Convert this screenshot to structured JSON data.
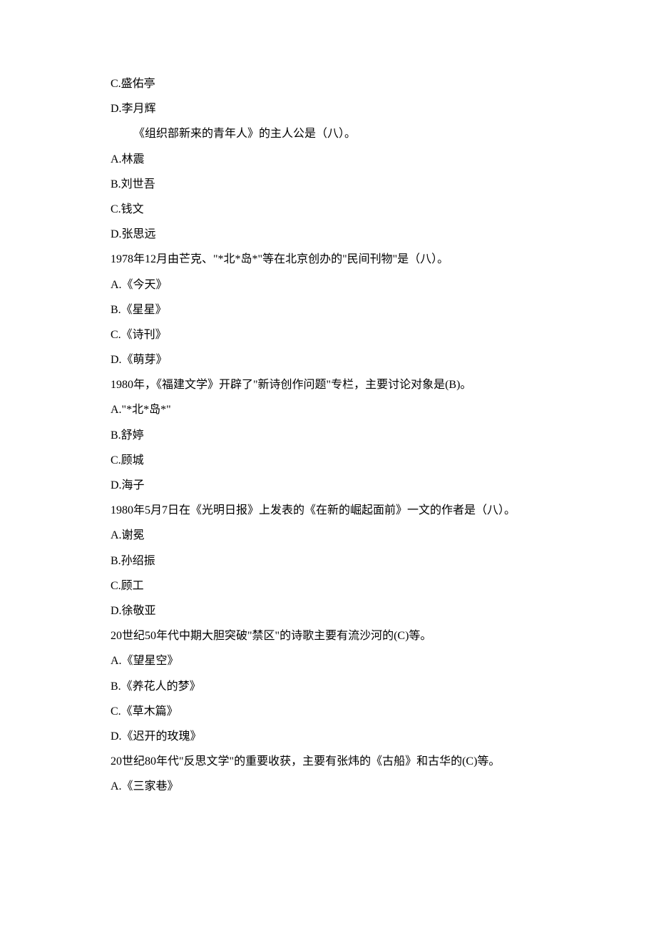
{
  "lines": [
    {
      "text": "C.盛佑亭",
      "indent": false
    },
    {
      "text": "D.李月辉",
      "indent": false
    },
    {
      "text": "《组织部新来的青年人》的主人公是（八）。",
      "indent": true
    },
    {
      "text": "A.林震",
      "indent": false
    },
    {
      "text": "B.刘世吾",
      "indent": false
    },
    {
      "text": "C.钱文",
      "indent": false
    },
    {
      "text": "D.张思远",
      "indent": false
    },
    {
      "text": "1978年12月由芒克、\"*北*岛*\"等在北京创办的\"民间刊物\"是（八）。",
      "indent": false
    },
    {
      "text": "A.《今天》",
      "indent": false
    },
    {
      "text": "B.《星星》",
      "indent": false
    },
    {
      "text": "C.《诗刊》",
      "indent": false
    },
    {
      "text": "D.《萌芽》",
      "indent": false
    },
    {
      "text": "1980年，《福建文学》开辟了\"新诗创作问题\"专栏，主要讨论对象是(B)。",
      "indent": false
    },
    {
      "text": "A.\"*北*岛*\"",
      "indent": false
    },
    {
      "text": "B.舒婷",
      "indent": false
    },
    {
      "text": "C.顾城",
      "indent": false
    },
    {
      "text": "D.海子",
      "indent": false
    },
    {
      "text": "1980年5月7日在《光明日报》上发表的《在新的崛起面前》一文的作者是（八）。",
      "indent": false
    },
    {
      "text": "A.谢冕",
      "indent": false
    },
    {
      "text": "B.孙绍振",
      "indent": false
    },
    {
      "text": "C.顾工",
      "indent": false
    },
    {
      "text": "D.徐敬亚",
      "indent": false
    },
    {
      "text": "20世纪50年代中期大胆突破\"禁区\"的诗歌主要有流沙河的(C)等。",
      "indent": false
    },
    {
      "text": "A.《望星空》",
      "indent": false
    },
    {
      "text": "B.《养花人的梦》",
      "indent": false
    },
    {
      "text": "C.《草木篇》",
      "indent": false
    },
    {
      "text": "D.《迟开的玫瑰》",
      "indent": false
    },
    {
      "text": "20世纪80年代\"反思文学\"的重要收获，主要有张炜的《古船》和古华的(C)等。",
      "indent": false
    },
    {
      "text": "A.《三家巷》",
      "indent": false
    }
  ]
}
